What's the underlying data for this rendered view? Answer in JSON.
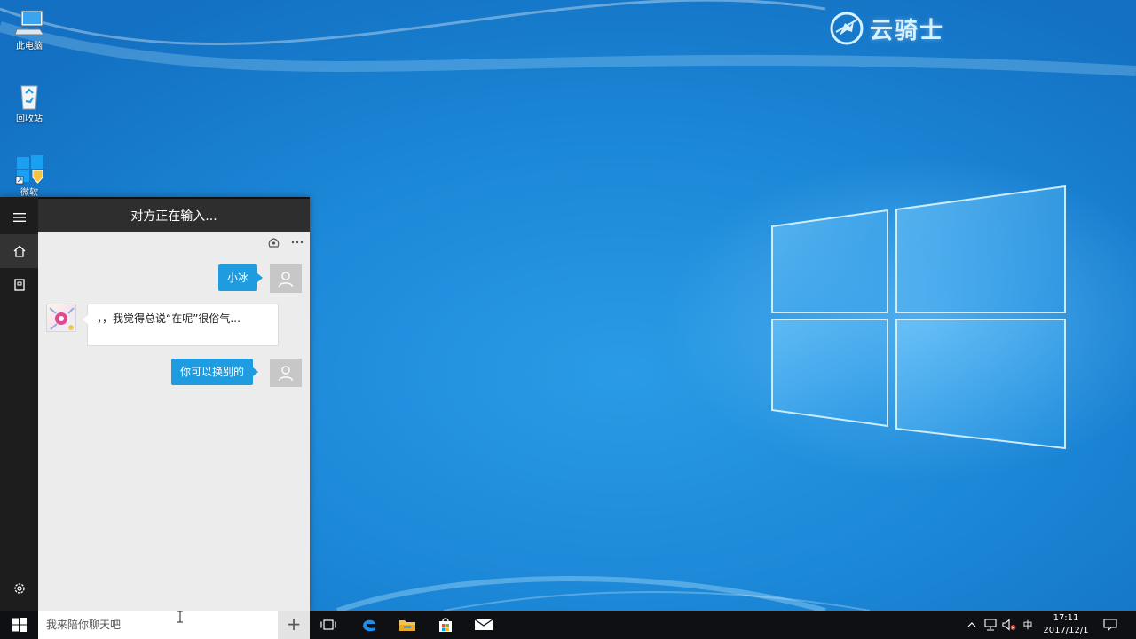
{
  "desktop": {
    "icons": [
      {
        "name": "this-pc",
        "label": "此电脑"
      },
      {
        "name": "recycle-bin",
        "label": "回收站"
      },
      {
        "name": "shortcut",
        "label": "微软"
      }
    ],
    "brand": {
      "text": "云骑士"
    }
  },
  "chat": {
    "header_title": "对方正在输入...",
    "nav": [
      "menu-icon",
      "home-icon",
      "notebook-icon",
      "settings-icon"
    ],
    "toolbar": [
      "share-icon",
      "more-icon"
    ],
    "messages": [
      {
        "from": "user",
        "text": "小冰"
      },
      {
        "from": "bot",
        "text": "，，我觉得总说“在呢”很俗气..."
      },
      {
        "from": "user",
        "text": "你可以换别的"
      }
    ],
    "input": {
      "placeholder": "我来陪你聊天吧",
      "value": ""
    },
    "add_label": "+"
  },
  "taskbar": {
    "pinned": [
      "task-view-icon",
      "edge-icon",
      "file-explorer-icon",
      "store-icon",
      "mail-icon"
    ],
    "tray": {
      "ime": "中",
      "time": "17:11",
      "date": "2017/12/1"
    }
  },
  "colors": {
    "accent": "#1f9be0",
    "taskbar": "#0f1013",
    "nav": "#1d1d1d"
  }
}
